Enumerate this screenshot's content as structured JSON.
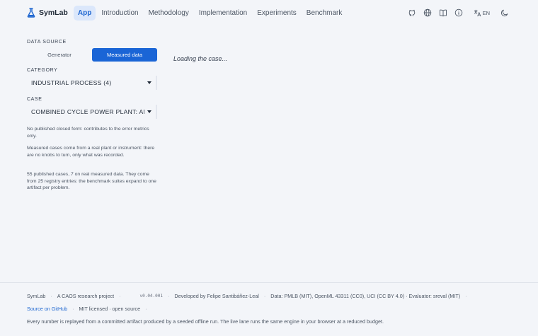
{
  "header": {
    "brand": "SymLab",
    "nav": [
      "App",
      "Introduction",
      "Methodology",
      "Implementation",
      "Experiments",
      "Benchmark"
    ],
    "active_nav": "App",
    "tools": [
      "github-icon",
      "globe-icon",
      "book-icon",
      "info-icon"
    ],
    "language": "EN",
    "theme_icon": "moon-icon"
  },
  "sidebar": {
    "data_source_label": "DATA SOURCE",
    "data_source_options": [
      "Generator",
      "Measured data"
    ],
    "data_source_selected": "Measured data",
    "category_label": "CATEGORY",
    "category_value": "INDUSTRIAL PROCESS (4)",
    "case_label": "CASE",
    "case_value": "COMBINED CYCLE POWER PLANT: AMB",
    "notes": [
      "No published closed form: contributes to the error metrics only.",
      "Measured cases come from a real plant or instrument: there are no knobs to turn, only what was recorded.",
      "55 published cases, 7 on real measured data. They come from 25 registry entries: the benchmark suites expand to one artifact per problem."
    ]
  },
  "main": {
    "loading_text": "Loading the case..."
  },
  "footer": {
    "brand": "SymLab",
    "tagline": "A CAOS research project",
    "version": "v0.04.001",
    "developer": "Developed by Felipe Santibáñez-Leal",
    "data_credits": "Data: PMLB (MIT), OpenML 43311 (CC0), UCI (CC BY 4.0) · Evaluator: sreval (MIT)",
    "github_link": "Source on GitHub",
    "license": "MIT licensed · open source",
    "disclaimer": "Every number is replayed from a committed artifact produced by a seeded offline run. The live lane runs the same engine in your browser at a reduced budget."
  },
  "colors": {
    "accent": "#1a65d6",
    "active_nav_bg": "#dbe7fb",
    "background": "#f3f5f9"
  }
}
